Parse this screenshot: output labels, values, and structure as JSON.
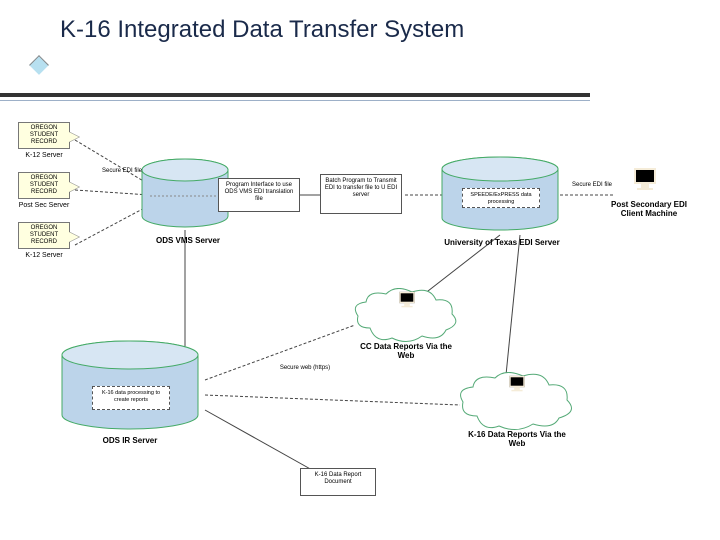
{
  "title": "K-16 Integrated Data Transfer System",
  "left_boxes": {
    "y1": "OREGON STUDENT RECORD",
    "y1_sub": "K-12 Server",
    "y2": "OREGON STUDENT RECORD",
    "y2_sub": "Post Sec Server",
    "y3": "OREGON STUDENT RECORD",
    "y3_sub": "K-12 Server"
  },
  "arrows": {
    "secure_edi": "Secure EDI file",
    "secure_edi2": "Secure EDI file",
    "secure_web": "Secure web (https)"
  },
  "process_boxes": {
    "p1": "Program Interface to use ODS VMS EDI translation file",
    "p2": "Batch Program to Transmit EDI to transfer file to U EDI server"
  },
  "cylinders": {
    "cyl1_label": "ODS VMS Server",
    "cyl2_text": "SPEEDE/ExPRESS data processing",
    "cyl2_label": "University of Texas EDI Server",
    "cyl3_text": "K-16 data processing to create reports",
    "cyl3_label": "ODS IR Server"
  },
  "right": {
    "caption": "Post Secondary EDI Client Machine"
  },
  "clouds": {
    "cc": "CC Data Reports Via the Web",
    "k16": "K-16 Data Reports Via the Web"
  },
  "doc": {
    "label": "K-16 Data Report Document"
  }
}
